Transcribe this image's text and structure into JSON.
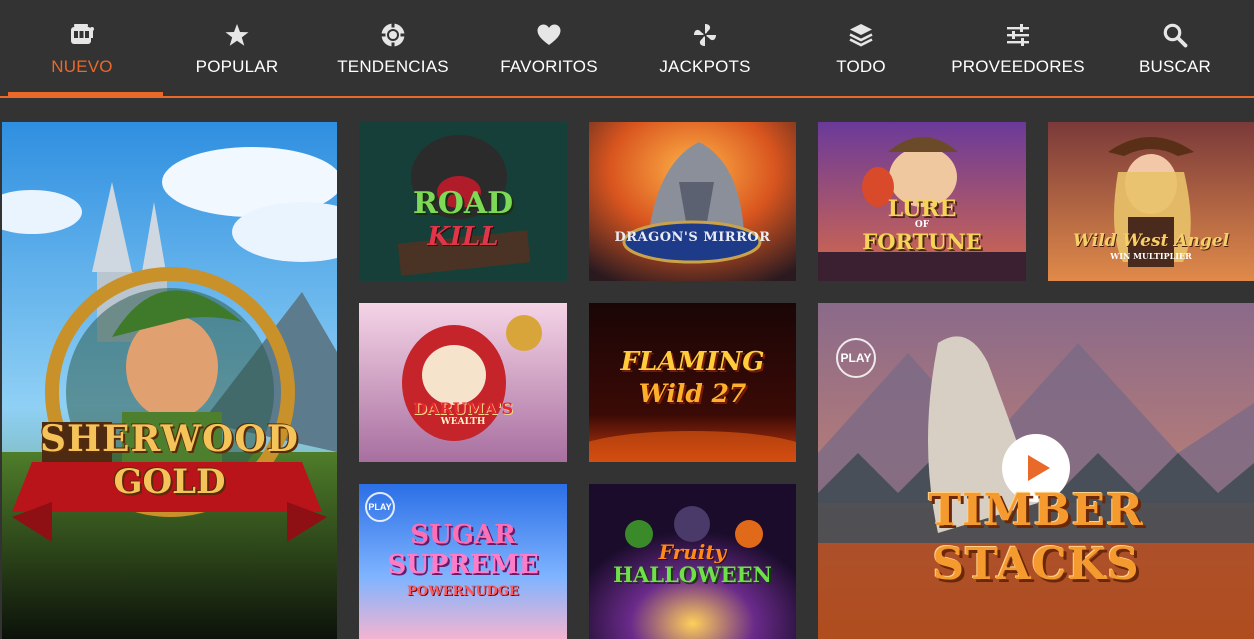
{
  "nav": {
    "tabs": [
      {
        "label": "NUEVO",
        "icon": "slot-machine-icon"
      },
      {
        "label": "POPULAR",
        "icon": "star-icon"
      },
      {
        "label": "TENDENCIAS",
        "icon": "chip-icon"
      },
      {
        "label": "FAVORITOS",
        "icon": "heart-icon"
      },
      {
        "label": "JACKPOTS",
        "icon": "pinwheel-icon"
      },
      {
        "label": "TODO",
        "icon": "layers-icon"
      },
      {
        "label": "PROVEEDORES",
        "icon": "sliders-icon"
      },
      {
        "label": "BUSCAR",
        "icon": "search-icon"
      }
    ],
    "active_tab": "NUEVO"
  },
  "colors": {
    "accent": "#e8692a",
    "background": "#333333",
    "text": "#ffffff"
  },
  "games": {
    "sherwood": {
      "line1": "SHERWOOD",
      "line2": "GOLD"
    },
    "roadkill": {
      "line1": "ROAD",
      "line2": "KILL"
    },
    "dragons_mirror": {
      "title": "DRAGON'S MIRROR"
    },
    "lure": {
      "line1": "LURE",
      "line2": "OF",
      "line3": "FORTUNE"
    },
    "wild_west": {
      "title": "Wild West Angel",
      "subtitle": "WIN MULTIPLIER"
    },
    "daruma": {
      "title": "DARUMA'S",
      "subtitle": "WEALTH"
    },
    "flaming": {
      "line1": "FLAMING",
      "line2": "Wild 27"
    },
    "sugar": {
      "line1": "SUGAR",
      "line2": "SUPREME",
      "line3": "POWERNUDGE",
      "badge": "PLAY"
    },
    "fruity": {
      "line1": "Fruity",
      "line2": "HALLOWEEN"
    },
    "timber": {
      "line1": "TIMBER",
      "line2": "STACKS",
      "badge": "PLAY"
    }
  }
}
